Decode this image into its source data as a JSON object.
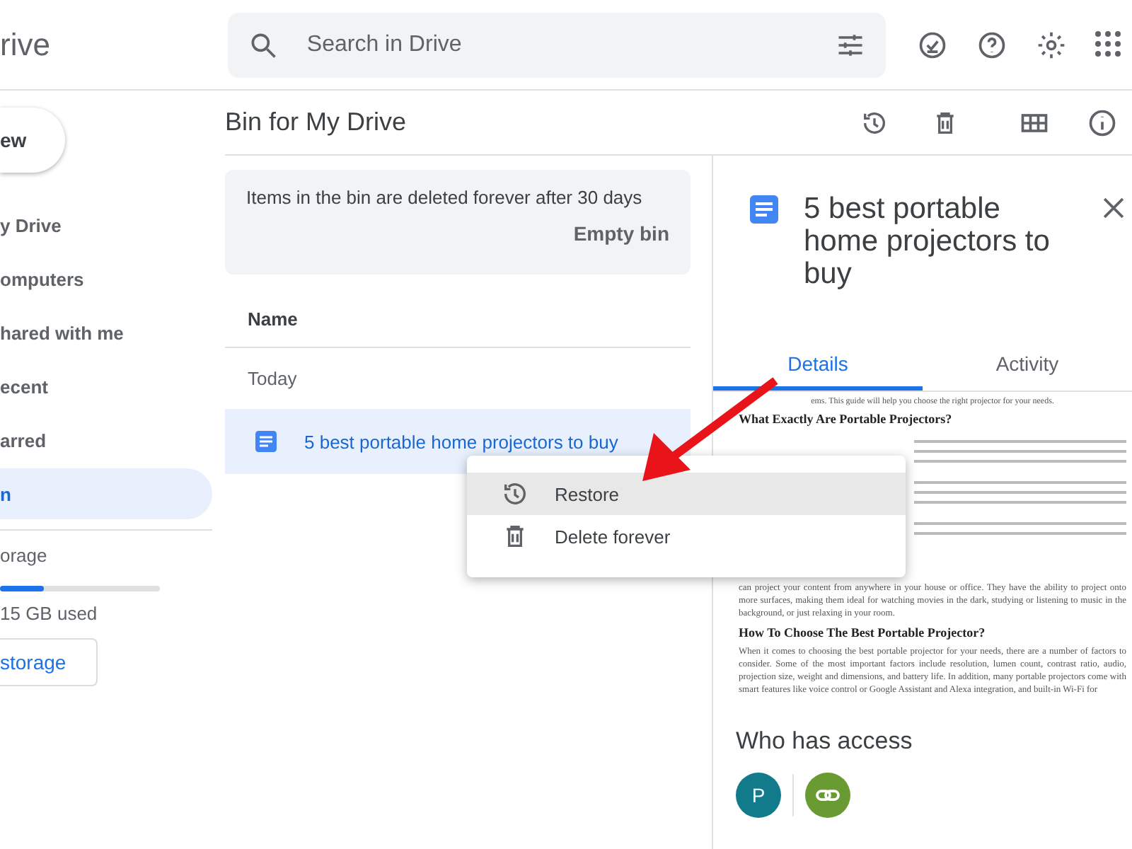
{
  "header": {
    "logo_text": "rive",
    "search": {
      "placeholder": "Search in Drive"
    }
  },
  "sidebar": {
    "new_button": "ew",
    "items": [
      {
        "label": "y Drive",
        "selected": false
      },
      {
        "label": "omputers",
        "selected": false
      },
      {
        "label": "hared with me",
        "selected": false
      },
      {
        "label": "ecent",
        "selected": false
      },
      {
        "label": "arred",
        "selected": false
      },
      {
        "label": "n",
        "selected": true
      }
    ],
    "storage": {
      "label": "orage",
      "level": 0.27,
      "used": "15 GB used",
      "button": "storage"
    }
  },
  "main": {
    "title": "Bin for My Drive",
    "notice": {
      "text": "Items in the bin are deleted forever after 30 days",
      "action": "Empty bin"
    },
    "column": "Name",
    "group": "Today",
    "files": [
      {
        "name": "5 best portable home projectors to buy",
        "selected": true
      }
    ]
  },
  "context_menu": {
    "items": [
      {
        "label": "Restore",
        "kind": "restore",
        "highlighted": true
      },
      {
        "label": "Delete forever",
        "kind": "delete",
        "highlighted": false
      }
    ]
  },
  "details": {
    "title": "5 best portable home projectors to buy",
    "tabs": [
      {
        "label": "Details",
        "selected": true
      },
      {
        "label": "Activity",
        "selected": false
      }
    ],
    "preview": [
      {
        "kind": "line",
        "text": "ems. This guide will help you choose the right projector for your needs."
      },
      {
        "kind": "heading",
        "text": "What Exactly Are Portable Projectors?"
      },
      {
        "kind": "blur"
      },
      {
        "kind": "para",
        "text": "can project your content from anywhere in your house or office. They have the ability to project onto more surfaces, making them ideal for watching movies in the dark, studying or listening to music in the background, or just relaxing in your room."
      },
      {
        "kind": "heading",
        "text": "How To Choose The Best Portable Projector?"
      },
      {
        "kind": "para",
        "text": "When it comes to choosing the best portable projector for your needs, there are a number of factors to consider. Some of the most important factors include resolution, lumen count, contrast ratio, audio, projection size, weight and dimensions, and battery life. In addition, many portable projectors come with smart features like voice control or Google Assistant and Alexa integration, and built-in Wi-Fi for"
      }
    ],
    "access_title": "Who has access",
    "access": [
      {
        "kind": "person",
        "initial": "P",
        "color": "#117b8c"
      },
      {
        "kind": "link",
        "color": "#6a9a32"
      }
    ]
  }
}
